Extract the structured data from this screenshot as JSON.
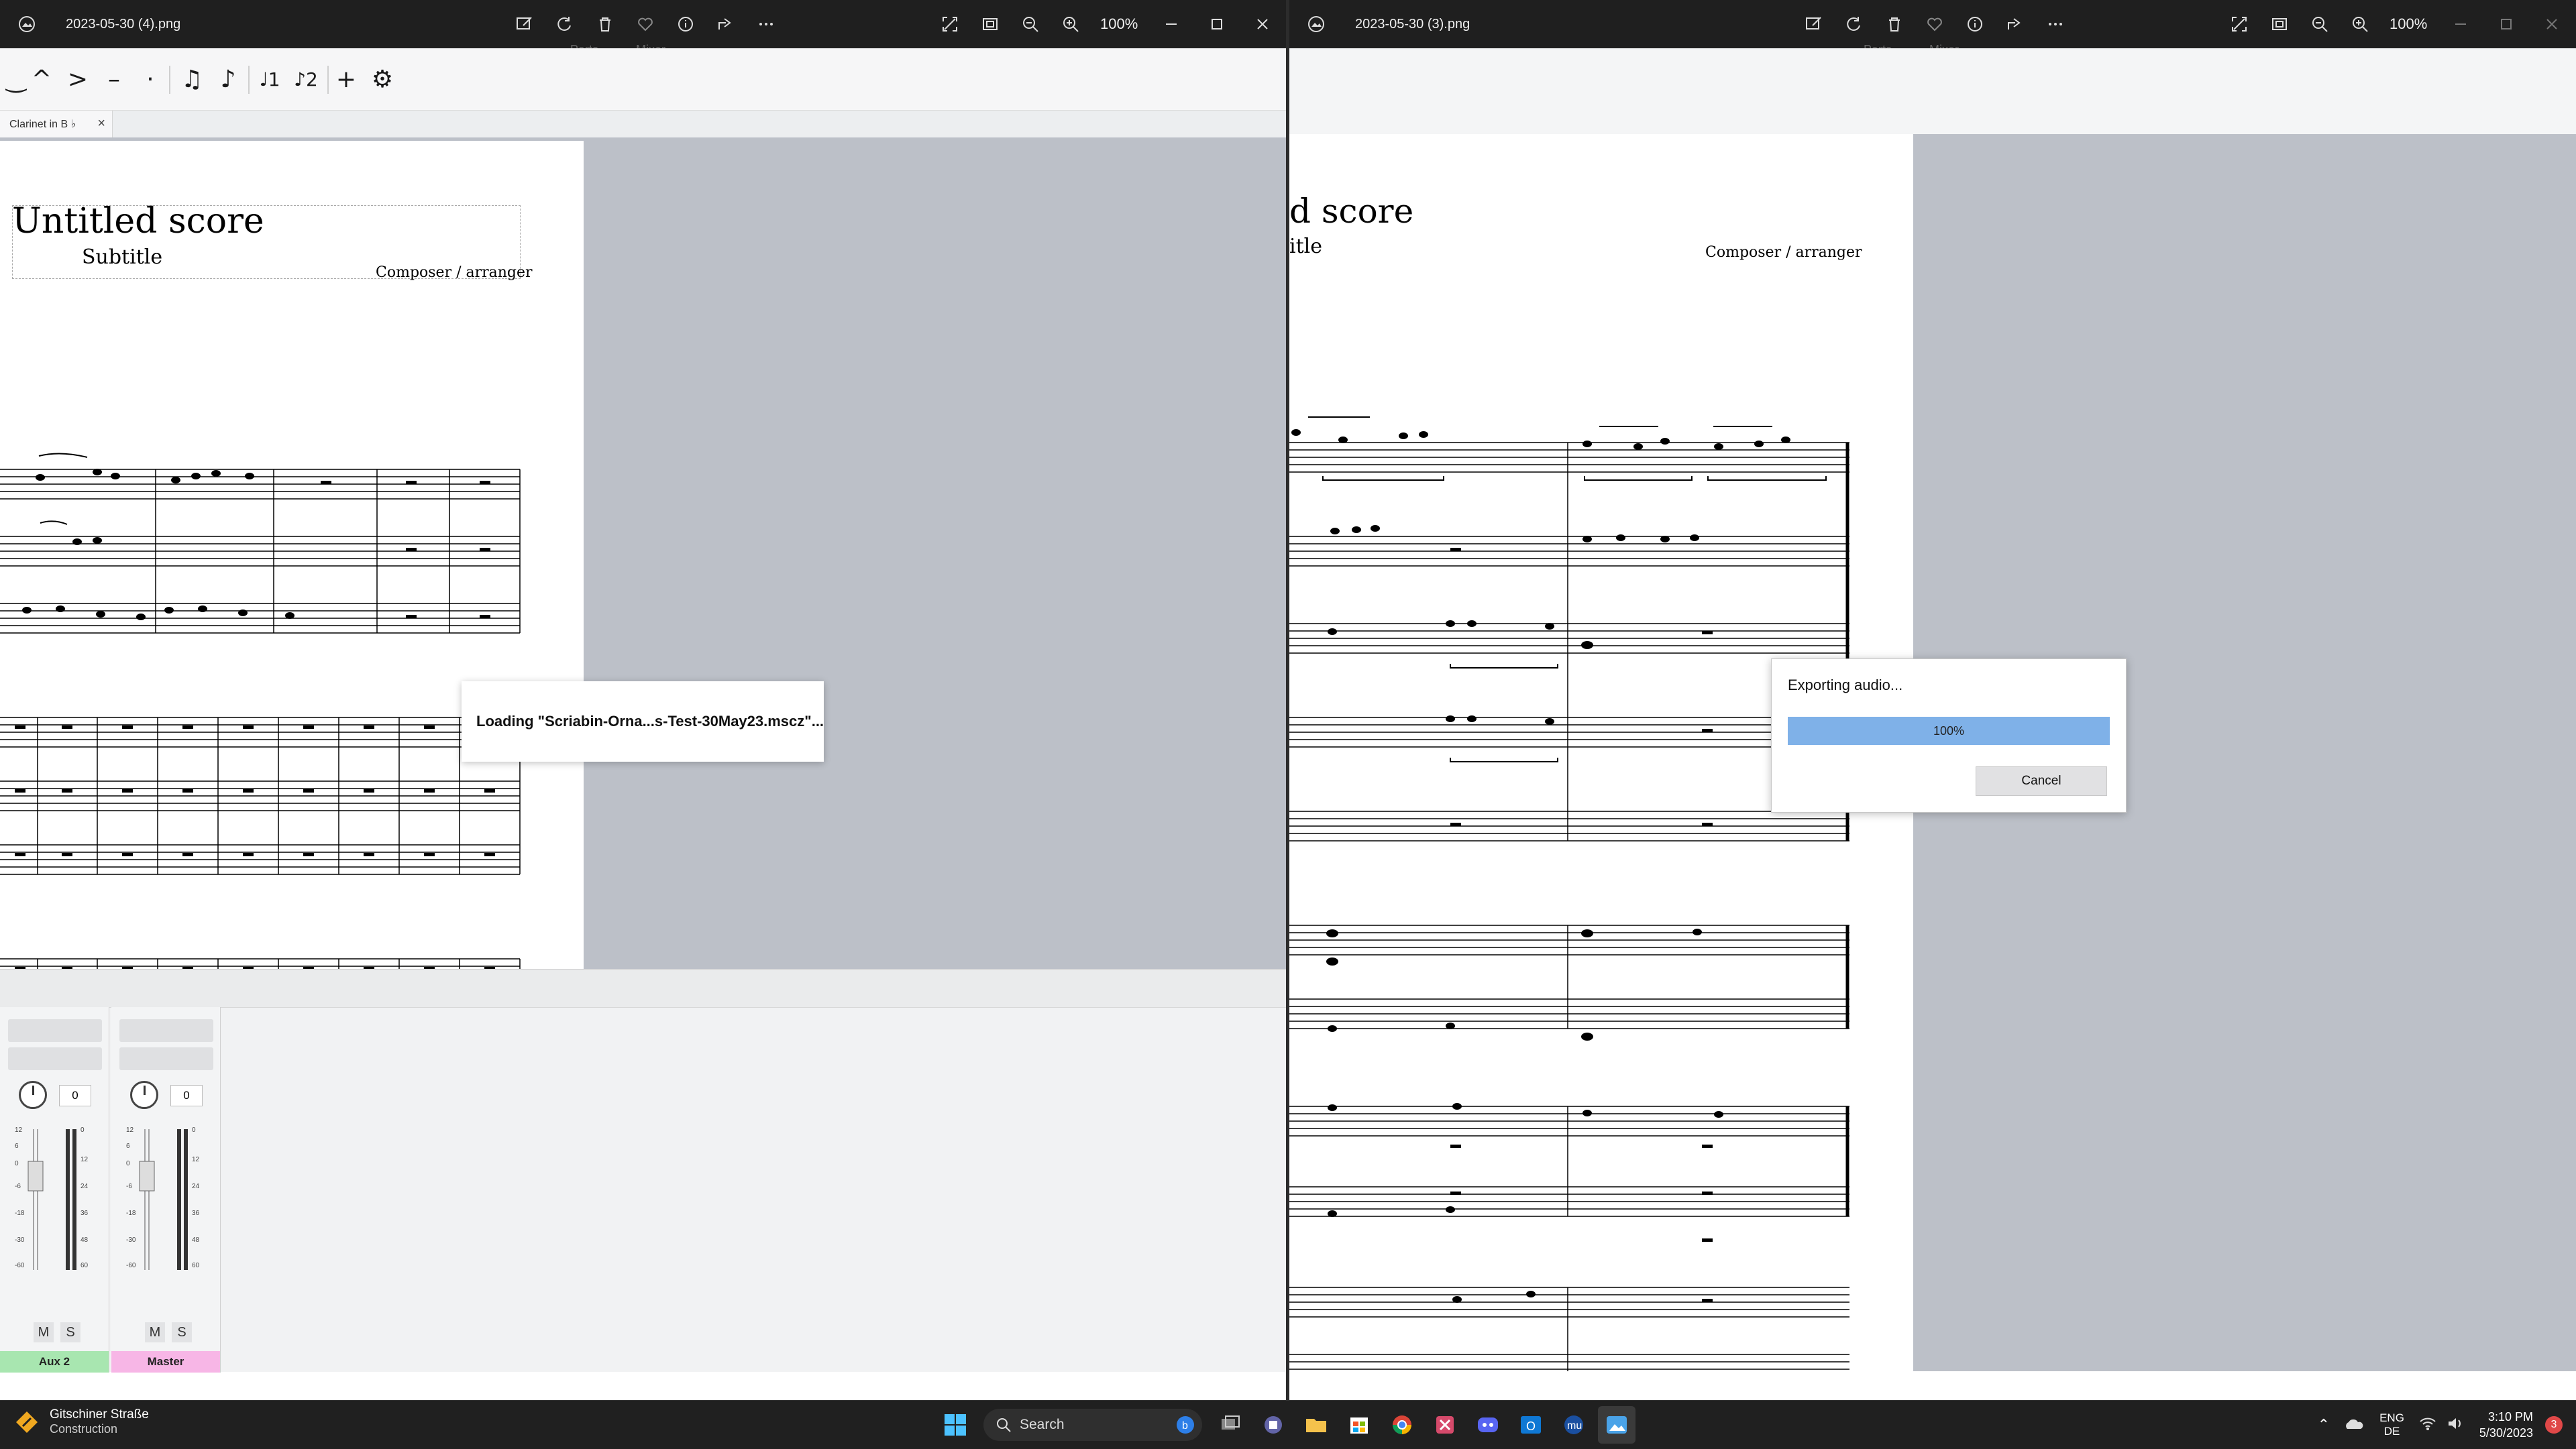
{
  "left_window": {
    "filename": "2023-05-30 (4).png",
    "zoom": "100%",
    "tab_label": "Clarinet in B ♭",
    "score": {
      "title": "Untitled score",
      "subtitle": "Subtitle",
      "composer": "Composer / arranger"
    },
    "top_cut": [
      "Parts",
      "Mixer"
    ],
    "loading_text": "Loading \"Scriabin-Orna...s-Test-30May23.mscz\"...",
    "mixer": {
      "strips": [
        {
          "label": "Aux 2",
          "value": "0",
          "mute": "M",
          "solo": "S",
          "color": "#a8e6b0"
        },
        {
          "label": "Master",
          "value": "0",
          "mute": "M",
          "solo": "S",
          "color": "#f7b6e6"
        }
      ]
    }
  },
  "right_window": {
    "filename": "2023-05-30 (3).png",
    "zoom": "100%",
    "top_cut": [
      "Parts",
      "Mixer"
    ],
    "score": {
      "title_visible": "d score",
      "subtitle_visible": "itle",
      "composer": "Composer / arranger"
    },
    "export_dialog": {
      "title": "Exporting audio...",
      "progress_label": "100%",
      "progress": 1.0,
      "cancel": "Cancel"
    }
  },
  "taskbar": {
    "weather_line1": "Gitschiner Straße",
    "weather_line2": "Construction",
    "search": "Search",
    "lang_line1": "ENG",
    "lang_line2": "DE",
    "time": "3:10 PM",
    "date": "5/30/2023",
    "notifications": "3"
  }
}
